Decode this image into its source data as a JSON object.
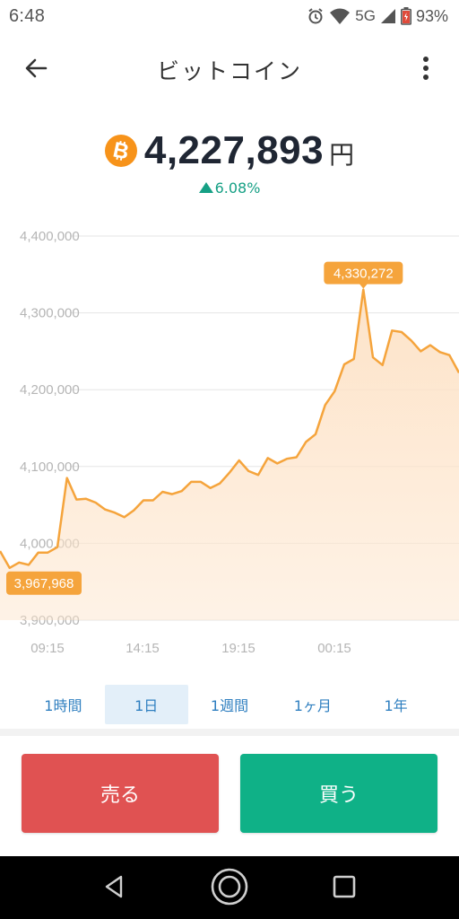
{
  "status_bar": {
    "time": "6:48",
    "network": "5G",
    "battery": "93%",
    "icons": [
      "alarm-icon",
      "wifi-icon",
      "signal-icon",
      "battery-icon"
    ]
  },
  "header": {
    "title": "ビットコイン",
    "back_icon": "arrow-left-icon",
    "menu_icon": "more-vert-icon"
  },
  "price": {
    "coin_icon": "bitcoin-icon",
    "value": "4,227,893",
    "unit": "円",
    "change": "6.08%",
    "change_direction": "up"
  },
  "chart_data": {
    "type": "area",
    "x_ticks": [
      "09:15",
      "14:15",
      "19:15",
      "00:15"
    ],
    "y_ticks": [
      "4,400,000",
      "4,300,000",
      "4,200,000",
      "4,100,000",
      "4,000,000",
      "3,900,000"
    ],
    "ylim": [
      3900000,
      4400000
    ],
    "high_label": "4,330,272",
    "low_label": "3,967,968",
    "values": [
      3990000,
      3968000,
      3975000,
      3972000,
      3988000,
      3988000,
      3995000,
      4085000,
      4057000,
      4058000,
      4053000,
      4044000,
      4040000,
      4034000,
      4043000,
      4056000,
      4056000,
      4067000,
      4064000,
      4068000,
      4080000,
      4080000,
      4072000,
      4078000,
      4092000,
      4108000,
      4094000,
      4089000,
      4111000,
      4104000,
      4110000,
      4112000,
      4132000,
      4142000,
      4180000,
      4198000,
      4233000,
      4240000,
      4330272,
      4242000,
      4232000,
      4277000,
      4275000,
      4264000,
      4250000,
      4258000,
      4249000,
      4245000,
      4222000
    ],
    "line_color": "#f5a43c",
    "fill_color": "#fde3c8",
    "grid": true
  },
  "periods": {
    "items": [
      "1時間",
      "1日",
      "1週間",
      "1ヶ月",
      "1年"
    ],
    "selected": "1日"
  },
  "actions": {
    "sell": "売る",
    "buy": "買う",
    "sell_color": "#e05252",
    "buy_color": "#0fb187"
  },
  "nav_bar": {
    "icons": [
      "back-triangle-icon",
      "home-circle-icon",
      "recents-square-icon"
    ]
  }
}
